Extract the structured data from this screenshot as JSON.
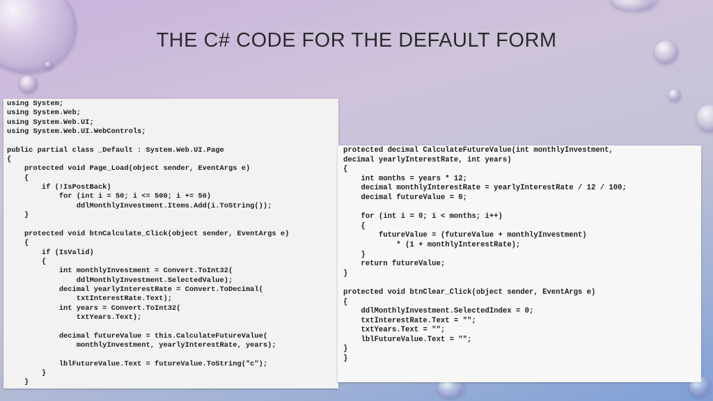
{
  "slide": {
    "title": "THE C# CODE FOR THE DEFAULT FORM"
  },
  "left_code": [
    "using System;",
    "using System.Web;",
    "using System.Web.UI;",
    "using System.Web.UI.WebControls;",
    "",
    "public partial class _Default : System.Web.UI.Page",
    "{",
    "    protected void Page_Load(object sender, EventArgs e)",
    "    {",
    "        if (!IsPostBack)",
    "            for (int i = 50; i <= 500; i += 50)",
    "                ddlMonthlyInvestment.Items.Add(i.ToString());",
    "    }",
    "",
    "    protected void btnCalculate_Click(object sender, EventArgs e)",
    "    {",
    "        if (IsValid)",
    "        {",
    "            int monthlyInvestment = Convert.ToInt32(",
    "                ddlMonthlyInvestment.SelectedValue);",
    "            decimal yearlyInterestRate = Convert.ToDecimal(",
    "                txtInterestRate.Text);",
    "            int years = Convert.ToInt32(",
    "                txtYears.Text);",
    "",
    "            decimal futureValue = this.CalculateFutureValue(",
    "                monthlyInvestment, yearlyInterestRate, years);",
    "",
    "            lblFutureValue.Text = futureValue.ToString(\"c\");",
    "        }",
    "    }"
  ],
  "right_code": [
    "protected decimal CalculateFutureValue(int monthlyInvestment,",
    "decimal yearlyInterestRate, int years)",
    "{",
    "    int months = years * 12;",
    "    decimal monthlyInterestRate = yearlyInterestRate / 12 / 100;",
    "    decimal futureValue = 0;",
    "",
    "    for (int i = 0; i < months; i++)",
    "    {",
    "        futureValue = (futureValue + monthlyInvestment)",
    "            * (1 + monthlyInterestRate);",
    "    }",
    "    return futureValue;",
    "}",
    "",
    "protected void btnClear_Click(object sender, EventArgs e)",
    "{",
    "    ddlMonthlyInvestment.SelectedIndex = 0;",
    "    txtInterestRate.Text = \"\";",
    "    txtYears.Text = \"\";",
    "    lblFutureValue.Text = \"\";",
    "}",
    "}"
  ]
}
